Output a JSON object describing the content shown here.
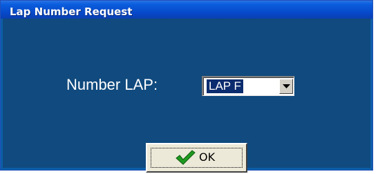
{
  "window": {
    "title": "Lap Number Request"
  },
  "form": {
    "number_lap_label": "Number LAP:",
    "number_lap_value": "LAP F"
  },
  "buttons": {
    "ok_label": "OK",
    "ok_icon": "checkmark-icon"
  },
  "colors": {
    "title_bar": "#0648c8",
    "dialog_background": "#104a7e",
    "label_text": "#ffffff",
    "checkmark": "#1f9a1f"
  }
}
